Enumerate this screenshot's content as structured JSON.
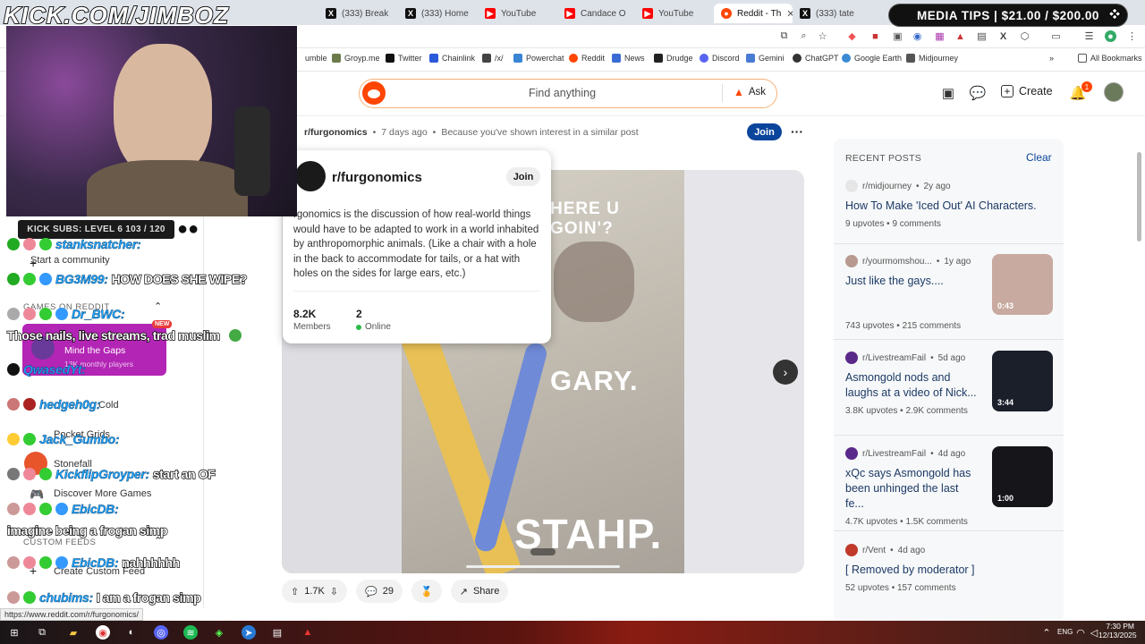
{
  "stream": {
    "logo_text": "KICK.COM/JIMBOZ",
    "media_tips": "MEDIA TIPS | $21.00 / $200.00",
    "kick_subs": "KICK SUBS: LEVEL 6 103 / 120"
  },
  "tabs": [
    {
      "label": "(333) Break",
      "icon": "x-icon"
    },
    {
      "label": "(333) Home",
      "icon": "x-icon"
    },
    {
      "label": "YouTube",
      "icon": "youtube-icon"
    },
    {
      "label": "Candace O",
      "icon": "youtube-icon"
    },
    {
      "label": "YouTube",
      "icon": "youtube-icon"
    },
    {
      "label": "Reddit - Th",
      "icon": "reddit-icon",
      "active": true
    },
    {
      "label": "(333) tate",
      "icon": "x-icon"
    }
  ],
  "bookmarks": [
    {
      "label": "umble",
      "color": "#7a9a3c"
    },
    {
      "label": "Groyp.me",
      "color": "#6b7b4a"
    },
    {
      "label": "Twitter",
      "color": "#111111"
    },
    {
      "label": "Chainlink",
      "color": "#2a5ada"
    },
    {
      "label": "/x/",
      "color": "#444444"
    },
    {
      "label": "Powerchat",
      "color": "#3a86d4"
    },
    {
      "label": "Reddit",
      "color": "#ff4500"
    },
    {
      "label": "News",
      "color": "#3a6bd4"
    },
    {
      "label": "Drudge",
      "color": "#222222"
    },
    {
      "label": "Discord",
      "color": "#5865f2"
    },
    {
      "label": "Gemini",
      "color": "#4a7bd4"
    },
    {
      "label": "ChatGPT",
      "color": "#333333"
    },
    {
      "label": "Google Earth",
      "color": "#3a8ad4"
    },
    {
      "label": "Midjourney",
      "color": "#555555"
    }
  ],
  "all_bookmarks": "All Bookmarks",
  "header": {
    "search_placeholder": "Find anything",
    "ask_label": "Ask",
    "create_label": "Create",
    "notif_count": "1"
  },
  "post": {
    "subreddit": "r/furgonomics",
    "time": "7 days ago",
    "reason": "Because you've shown interest in a similar post",
    "join_label": "Join",
    "upvotes": "1.7K",
    "comments": "29",
    "share_label": "Share",
    "image_texts": [
      "HERE U GOIN'?",
      "GARY.",
      "STAHP."
    ]
  },
  "hovercard": {
    "name": "r/furgonomics",
    "join_label": "Join",
    "description": "rgonomics is the discussion of how real-world things would have to be adapted to work in a world inhabited by anthropomorphic animals. (Like a chair with a hole in the back to accommodate for tails, or a hat with holes on the sides for large ears, etc.)",
    "members_value": "8.2K",
    "members_label": "Members",
    "online_value": "2",
    "online_label": "Online"
  },
  "recent": {
    "heading": "RECENT POSTS",
    "clear_label": "Clear",
    "posts": [
      {
        "sub": "r/midjourney",
        "age": "2y ago",
        "title": "How To Make 'Iced Out' AI Characters.",
        "upvotes": "9 upvotes",
        "comments": "9 comments"
      },
      {
        "sub": "r/yourmomshou...",
        "age": "1y ago",
        "title": "Just like the gays....",
        "upvotes": "743 upvotes",
        "comments": "215 comments",
        "duration": "0:43"
      },
      {
        "sub": "r/LivestreamFail",
        "age": "5d ago",
        "title": "Asmongold nods and laughs at a video of Nick...",
        "upvotes": "3.8K upvotes",
        "comments": "2.9K comments",
        "duration": "3:44"
      },
      {
        "sub": "r/LivestreamFail",
        "age": "4d ago",
        "title": "xQc says Asmongold has been unhinged the last fe...",
        "upvotes": "4.7K upvotes",
        "comments": "1.5K comments",
        "duration": "1:00"
      },
      {
        "sub": "r/Vent",
        "age": "4d ago",
        "title": "[ Removed by moderator ]",
        "upvotes": "52 upvotes",
        "comments": "157 comments"
      }
    ]
  },
  "leftnav": {
    "start_community": "Start a community",
    "games_heading": "GAMES ON REDDIT",
    "new_badge": "NEW",
    "game1": "Mind the Gaps",
    "game1_sub": "13K monthly players",
    "game2": "Cold",
    "game3": "Pocket Grids",
    "game4": "Stonefall",
    "discover": "Discover More Games",
    "custom_heading": "CUSTOM FEEDS",
    "create_feed": "Create Custom Feed"
  },
  "chat": [
    {
      "user": "stanksnatcher:",
      "msg": ""
    },
    {
      "user": "BG3M99:",
      "msg": "HOW DOES SHE WIPE?"
    },
    {
      "user": "Dr_BWC:",
      "msg": ""
    },
    {
      "user": "",
      "msg": "Those nails, live streams, trad muslim"
    },
    {
      "user": "QwasedYt:",
      "msg": ""
    },
    {
      "user": "hedgeh0g:",
      "msg": ""
    },
    {
      "user": "Jack_Gumbo:",
      "msg": ""
    },
    {
      "user": "KickflipGroyper:",
      "msg": "start an OF"
    },
    {
      "user": "EbicDB:",
      "msg": ""
    },
    {
      "user": "",
      "msg": "imagine being a frogan simp"
    },
    {
      "user": "EbicDB:",
      "msg": "nahhhhhh"
    },
    {
      "user": "chubims:",
      "msg": "I am a frogan simp"
    }
  ],
  "status_url": "https://www.reddit.com/r/furgonomics/",
  "clock": {
    "time": "7:30 PM",
    "date": "12/13/2025",
    "lang": "ENG"
  }
}
